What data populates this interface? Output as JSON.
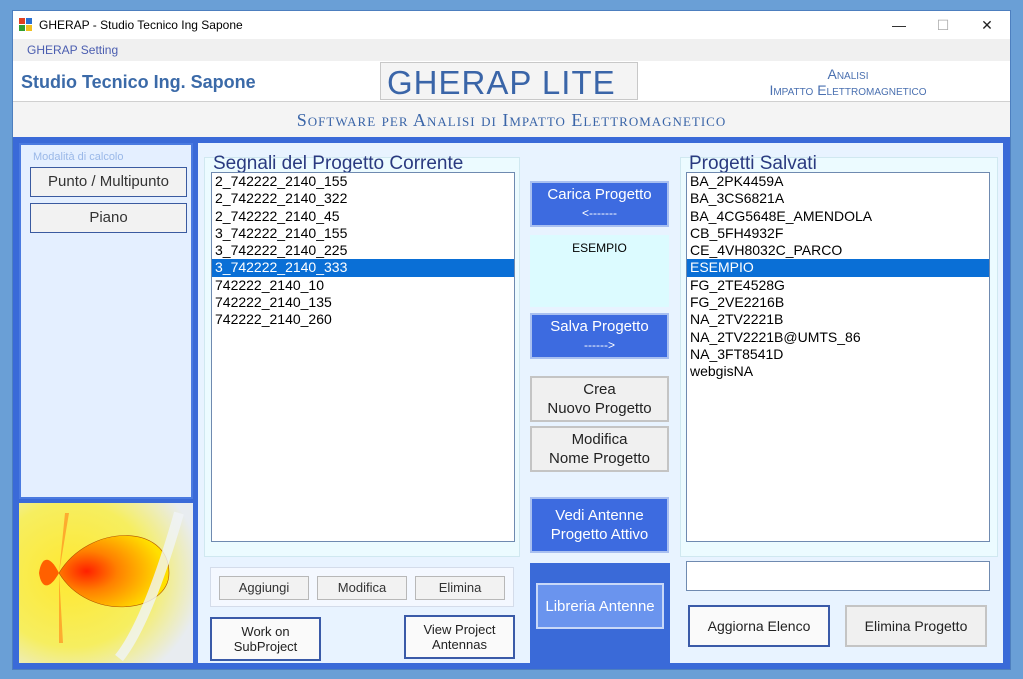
{
  "window": {
    "title": "GHERAP - Studio Tecnico Ing Sapone",
    "minimize": "—",
    "maximize": "☐",
    "close": "✕"
  },
  "menu": {
    "items": [
      "GHERAP Setting"
    ]
  },
  "header": {
    "studio": "Studio Tecnico Ing. Sapone",
    "app_name": "GHERAP LITE",
    "analisi_line1": "Analisi",
    "analisi_line2": "Impatto Elettromagnetico",
    "subtitle": "Software per Analisi di Impatto Elettromagnetico"
  },
  "sidebar": {
    "group_label": "Modalità di calcolo",
    "buttons": [
      "Punto / Multipunto",
      "Piano"
    ]
  },
  "signals": {
    "title": "Segnali del Progetto Corrente",
    "items": [
      "2_742222_2140_155",
      "2_742222_2140_322",
      "2_742222_2140_45",
      "3_742222_2140_155",
      "3_742222_2140_225",
      "3_742222_2140_333",
      "742222_2140_10",
      "742222_2140_135",
      "742222_2140_260"
    ],
    "selected": "3_742222_2140_333",
    "buttons": {
      "add": "Aggiungi",
      "edit": "Modifica",
      "delete": "Elimina"
    },
    "work_subproject_line1": "Work on",
    "work_subproject_line2": "SubProject",
    "view_antennas_line1": "View Project",
    "view_antennas_line2": "Antennas"
  },
  "middle": {
    "load_line1": "Carica Progetto",
    "load_line2": "<-------",
    "current_project": "ESEMPIO",
    "save_line1": "Salva Progetto",
    "save_line2": "------>",
    "new_line1": "Crea",
    "new_line2": "Nuovo Progetto",
    "rename_line1": "Modifica",
    "rename_line2": "Nome Progetto",
    "view_line1": "Vedi Antenne",
    "view_line2": "Progetto Attivo",
    "library": "Libreria Antenne"
  },
  "projects": {
    "title": "Progetti Salvati",
    "items": [
      "BA_2PK4459A",
      "BA_3CS6821A",
      "BA_4CG5648E_AMENDOLA",
      "CB_5FH4932F",
      "CE_4VH8032C_PARCO",
      "ESEMPIO",
      "FG_2TE4528G",
      "FG_2VE2216B",
      "NA_2TV2221B",
      "NA_2TV2221B@UMTS_86",
      "NA_3FT8541D",
      "webgisNA"
    ],
    "selected": "ESEMPIO",
    "name_field": "",
    "refresh": "Aggiorna Elenco",
    "delete": "Elimina Progetto"
  },
  "colors": {
    "main_blue": "#3a6ad8",
    "selection": "#0a6fd6",
    "title_blue": "#3a65a8"
  }
}
